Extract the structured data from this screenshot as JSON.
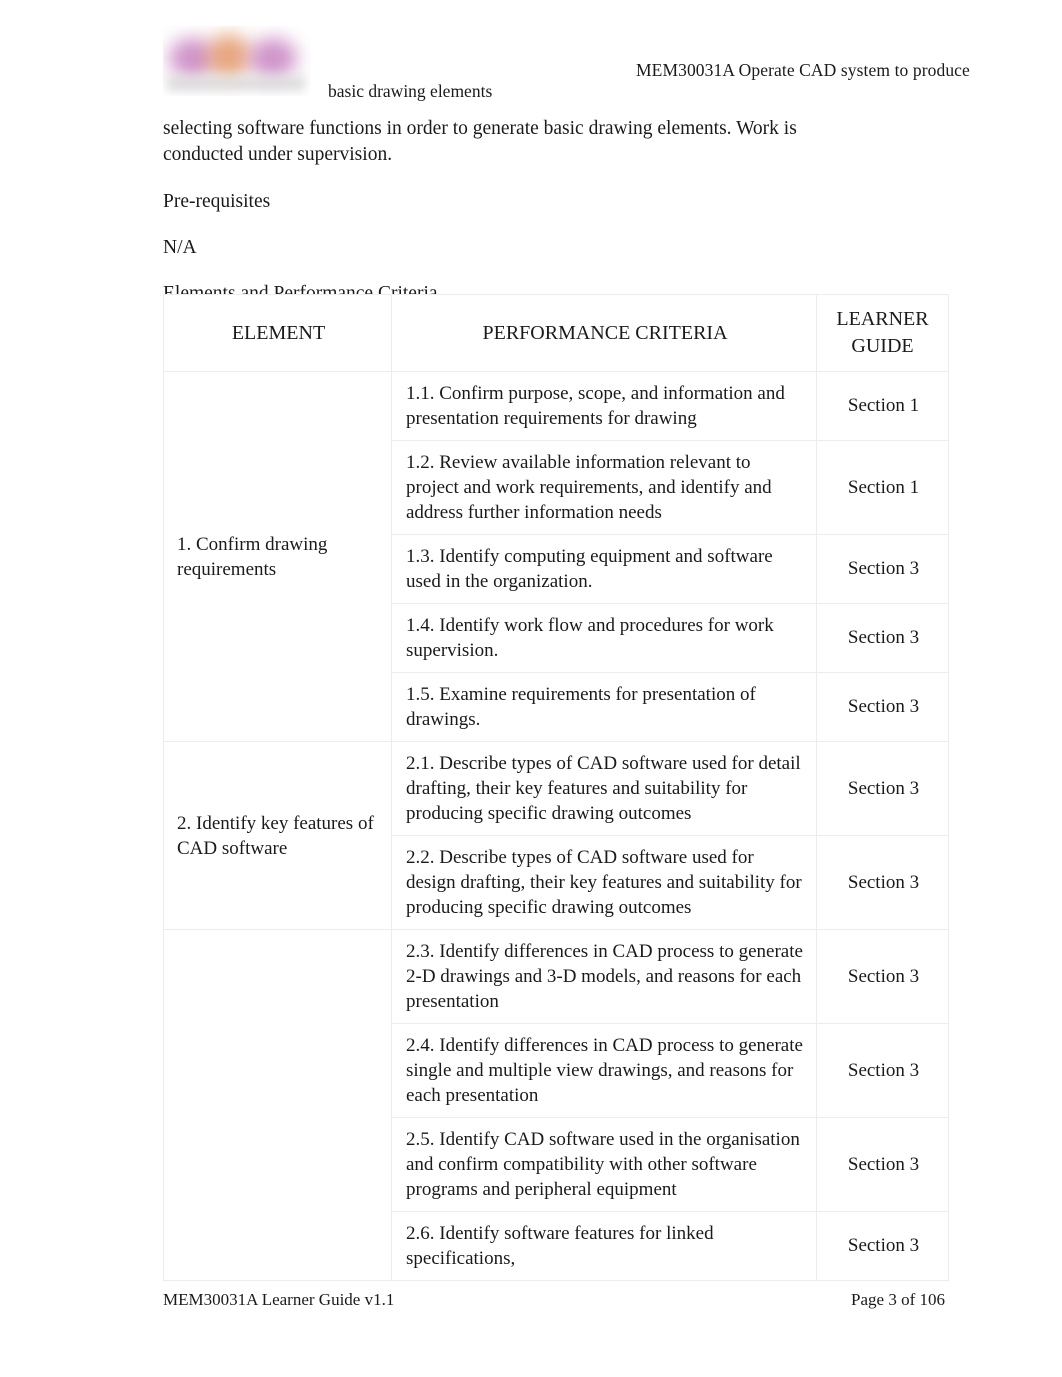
{
  "header": {
    "logo_name": "organisation-logo",
    "unit_title_line1": "MEM30031A  Operate CAD system to produce",
    "unit_title_line2": "basic drawing elements"
  },
  "body": {
    "intro_paragraph": "selecting software functions in order to generate basic drawing elements. Work is conducted under supervision.",
    "prerequisites_heading": "Pre-requisites",
    "prerequisites_value": "N/A",
    "section_heading": "Elements and Performance Criteria"
  },
  "table": {
    "headers": {
      "element": "ELEMENT",
      "criteria": "PERFORMANCE CRITERIA",
      "guide_line1": "LEARNER",
      "guide_line2": "GUIDE"
    },
    "elements": [
      {
        "label": "1. Confirm drawing requirements",
        "rows": [
          {
            "criteria": "1.1. Confirm purpose, scope, and information and presentation requirements for drawing",
            "guide": "Section 1"
          },
          {
            "criteria": "1.2. Review available information relevant to project and work requirements, and identify and address further information needs",
            "guide": "Section 1"
          },
          {
            "criteria": "1.3. Identify computing equipment and software used in the organization.",
            "guide": "Section 3"
          },
          {
            "criteria": "1.4. Identify work flow and procedures for work supervision.",
            "guide": "Section 3"
          },
          {
            "criteria": "1.5. Examine requirements for presentation of drawings.",
            "guide": "Section 3"
          }
        ]
      },
      {
        "label": "2. Identify key features of CAD software",
        "rows": [
          {
            "criteria": "2.1. Describe types of CAD software used for detail drafting, their key features and suitability for producing specific drawing outcomes",
            "guide": "Section 3"
          },
          {
            "criteria": "2.2. Describe types of CAD software used for design drafting, their key features and suitability for producing specific drawing outcomes",
            "guide": "Section 3"
          },
          {
            "criteria": "2.3. Identify differences in CAD process to generate 2-D drawings and 3-D models, and reasons for each presentation",
            "guide": "Section 3"
          },
          {
            "criteria": "2.4. Identify differences in CAD process to generate single and multiple view drawings, and reasons for each presentation",
            "guide": "Section 3"
          },
          {
            "criteria": "2.5. Identify CAD software used in the organisation and confirm compatibility with other software programs and peripheral equipment",
            "guide": "Section 3"
          },
          {
            "criteria": "2.6. Identify software features for linked specifications,",
            "guide": "Section 3"
          }
        ]
      }
    ]
  },
  "footer": {
    "left": "MEM30031A Learner Guide v1.1",
    "right": "Page 3 of 106"
  },
  "colors": {
    "text": "#1a1a1a",
    "table_border": "#ececec",
    "page_background": "#ffffff"
  }
}
